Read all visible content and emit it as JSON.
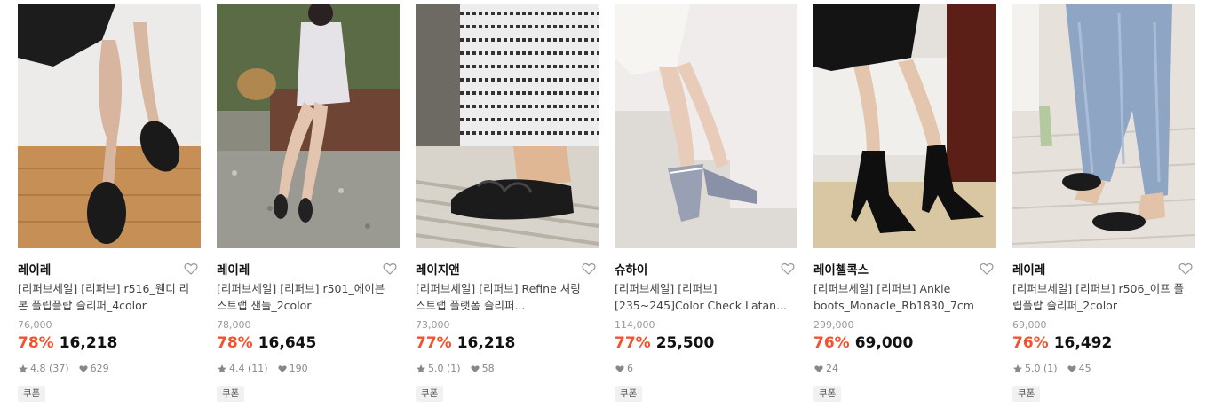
{
  "products": [
    {
      "brand": "레이레",
      "name": "[리퍼브세일] [리퍼브] r516_웬디 리본 플립플랍 슬리퍼_4color",
      "original_price": "76,000",
      "discount": "78%",
      "price": "16,218",
      "rating": "4.8",
      "review_count": "(37)",
      "likes": "629",
      "coupon": "쿠폰",
      "image_icon": "sandal-photo"
    },
    {
      "brand": "레이레",
      "name": "[리퍼브세일] [리퍼브] r501_에이븐 스트랩 샌들_2color",
      "original_price": "78,000",
      "discount": "78%",
      "price": "16,645",
      "rating": "4.4",
      "review_count": "(11)",
      "likes": "190",
      "coupon": "쿠폰",
      "image_icon": "sandal-photo"
    },
    {
      "brand": "레이지앤",
      "name": "[리퍼브세일] [리퍼브] Refine 셔링 스트랩 플랫폼 슬리퍼...",
      "original_price": "73,000",
      "discount": "77%",
      "price": "16,218",
      "rating": "5.0",
      "review_count": "(1)",
      "likes": "58",
      "coupon": "쿠폰",
      "image_icon": "slipper-photo"
    },
    {
      "brand": "슈하이",
      "name": "[리퍼브세일] [리퍼브] [235~245]Color Check Latan...",
      "original_price": "114,000",
      "discount": "77%",
      "price": "25,500",
      "rating": "",
      "review_count": "",
      "likes": "6",
      "coupon": "쿠폰",
      "image_icon": "mule-photo"
    },
    {
      "brand": "레이첼콕스",
      "name": "[리퍼브세일] [리퍼브] Ankle boots_Monacle_Rb1830_7cm",
      "original_price": "299,000",
      "discount": "76%",
      "price": "69,000",
      "rating": "",
      "review_count": "",
      "likes": "24",
      "coupon": "쿠폰",
      "image_icon": "boots-photo"
    },
    {
      "brand": "레이레",
      "name": "[리퍼브세일] [리퍼브] r506_이프 플립플랍 슬리퍼_2color",
      "original_price": "69,000",
      "discount": "76%",
      "price": "16,492",
      "rating": "5.0",
      "review_count": "(1)",
      "likes": "45",
      "coupon": "쿠폰",
      "image_icon": "flipflop-photo"
    }
  ],
  "colors": {
    "discount": "#f2522e",
    "muted": "#888888"
  }
}
